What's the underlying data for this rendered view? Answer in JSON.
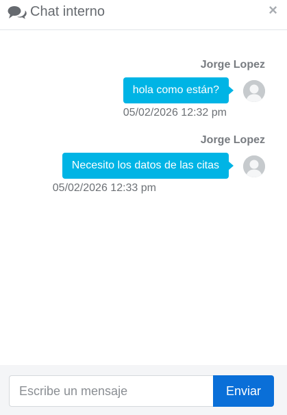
{
  "header": {
    "icon": "comments-icon",
    "title": "Chat interno",
    "close_label": "×"
  },
  "messages": [
    {
      "author": "Jorge Lopez",
      "text": "hola como están?",
      "timestamp": "05/02/2026 12:32 pm",
      "avatar_icon": "user-avatar-icon"
    },
    {
      "author": "Jorge Lopez",
      "text": "Necesito los datos de las citas",
      "timestamp": "05/02/2026 12:33 pm",
      "avatar_icon": "user-avatar-icon"
    }
  ],
  "composer": {
    "placeholder": "Escribe un mensaje",
    "value": "",
    "send_label": "Enviar"
  },
  "colors": {
    "bubble": "#00b4e5",
    "send_button": "#0a6fd8",
    "footer_bg": "#f4f5f7",
    "header_text": "#666a6f"
  }
}
